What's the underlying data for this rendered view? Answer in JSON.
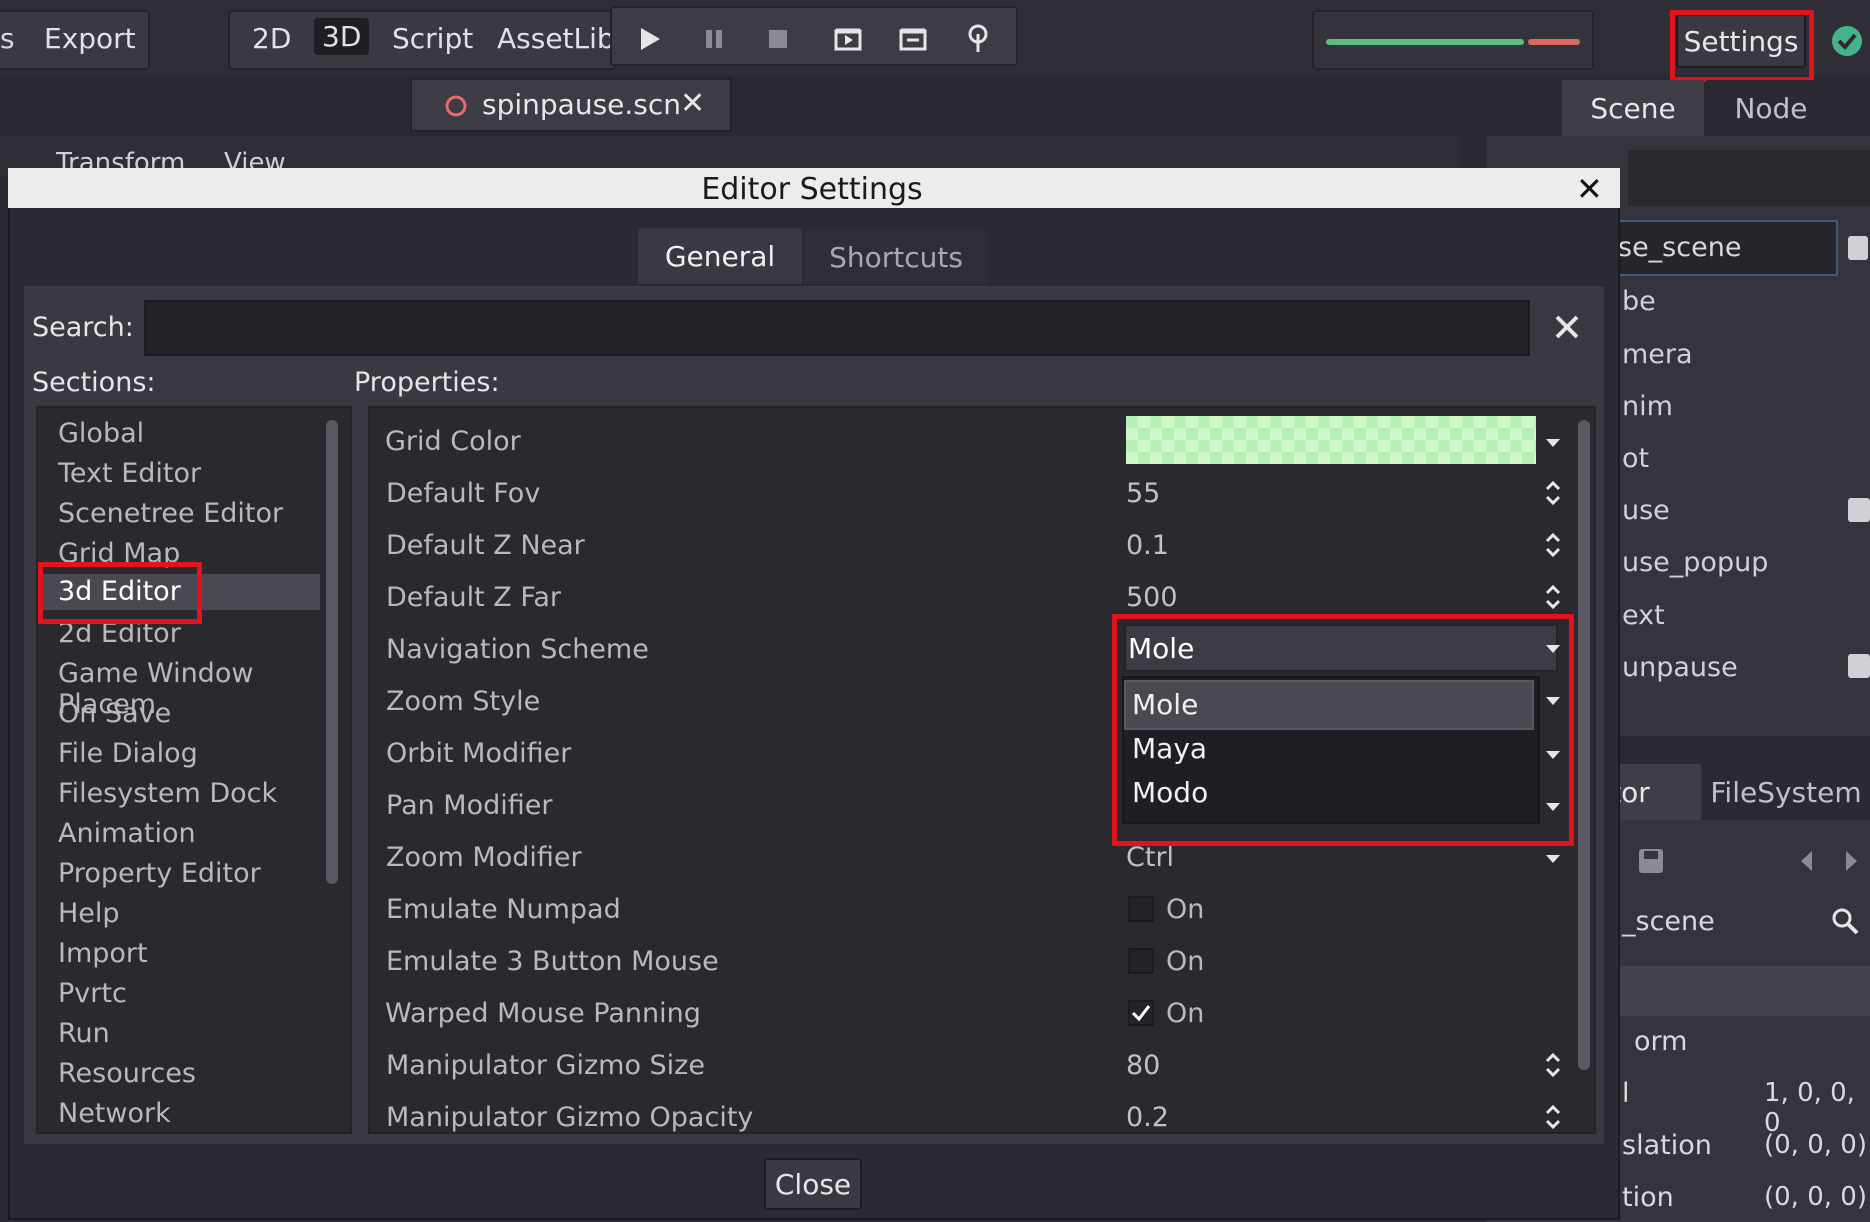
{
  "menubar": {
    "partial_item": "s",
    "export_label": "Export"
  },
  "modes": {
    "2d": "2D",
    "3d": "3D",
    "script": "Script",
    "assetlib": "AssetLib"
  },
  "topright": {
    "settings_label": "Settings"
  },
  "scene_tab": {
    "filename": "spinpause.scn",
    "close_glyph": "✕"
  },
  "viewport_menu": {
    "transform": "Transform",
    "view": "View"
  },
  "dock": {
    "tabs": {
      "scene": "Scene",
      "node": "Node"
    },
    "root_field": "se_scene",
    "tree_items": [
      "be",
      "mera",
      "nim",
      "ot",
      "use",
      "use_popup",
      "ext",
      "unpause"
    ],
    "bottom_tabs": {
      "inspector": "tor",
      "filesystem": "FileSystem"
    },
    "inspector_path": "_scene",
    "inspector_rows": [
      {
        "label": "orm",
        "value": ""
      },
      {
        "label": "l",
        "value": "1, 0, 0, 0"
      },
      {
        "label": "slation",
        "value": "(0, 0, 0)"
      },
      {
        "label": "tion",
        "value": "(0, 0, 0)"
      }
    ]
  },
  "dialog": {
    "title": "Editor Settings",
    "close_glyph": "✕",
    "tabs": {
      "general": "General",
      "shortcuts": "Shortcuts"
    },
    "search_label": "Search:",
    "search_value": "",
    "sections_label": "Sections:",
    "properties_label": "Properties:",
    "sections": [
      "Global",
      "Text Editor",
      "Scenetree Editor",
      "Grid Map",
      "3d Editor",
      "2d Editor",
      "Game Window Placem",
      "On Save",
      "File Dialog",
      "Filesystem Dock",
      "Animation",
      "Property Editor",
      "Help",
      "Import",
      "Pvrtc",
      "Run",
      "Resources",
      "Network"
    ],
    "selected_section": "3d Editor",
    "properties": {
      "grid_color": {
        "label": "Grid Color",
        "color": "#b6f0b4"
      },
      "default_fov": {
        "label": "Default Fov",
        "value": "55"
      },
      "default_z_near": {
        "label": "Default Z Near",
        "value": "0.1"
      },
      "default_z_far": {
        "label": "Default Z Far",
        "value": "500"
      },
      "navigation_scheme": {
        "label": "Navigation Scheme",
        "value": "Mole"
      },
      "zoom_style": {
        "label": "Zoom Style"
      },
      "orbit_modifier": {
        "label": "Orbit Modifier"
      },
      "pan_modifier": {
        "label": "Pan Modifier"
      },
      "zoom_modifier": {
        "label": "Zoom Modifier",
        "value": "Ctrl"
      },
      "emulate_numpad": {
        "label": "Emulate Numpad",
        "value": "On",
        "checked": false
      },
      "emulate_3_button_mouse": {
        "label": "Emulate 3 Button Mouse",
        "value": "On",
        "checked": false
      },
      "warped_mouse_panning": {
        "label": "Warped Mouse Panning",
        "value": "On",
        "checked": true
      },
      "manipulator_gizmo_size": {
        "label": "Manipulator Gizmo Size",
        "value": "80"
      },
      "manipulator_gizmo_opacity": {
        "label": "Manipulator Gizmo Opacity",
        "value": "0.2"
      }
    },
    "navigation_options": [
      "Mole",
      "Maya",
      "Modo"
    ],
    "close_button": "Close"
  },
  "colors": {
    "highlight": "#e0141c",
    "accent_check": "#45b38a",
    "bg": "#2b2a33"
  }
}
